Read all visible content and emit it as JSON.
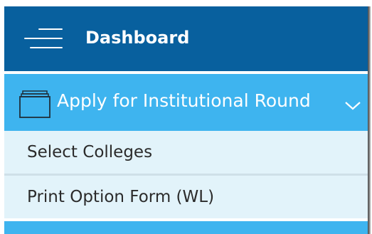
{
  "header": {
    "menu_icon": "hamburger-icon",
    "title": "Dashboard"
  },
  "menu": {
    "parent": {
      "icon": "folder-icon",
      "label": "Apply for Institutional Round",
      "expand_icon": "chevron-down-icon"
    },
    "items": [
      {
        "label": "Select Colleges"
      },
      {
        "label": "Print Option Form (WL)"
      }
    ]
  },
  "colors": {
    "header_bg": "#08609e",
    "active_bg": "#3eb4ef",
    "submenu_bg": "#e2f3fa",
    "text_dark": "#2b2b2b",
    "text_light": "#ffffff"
  }
}
